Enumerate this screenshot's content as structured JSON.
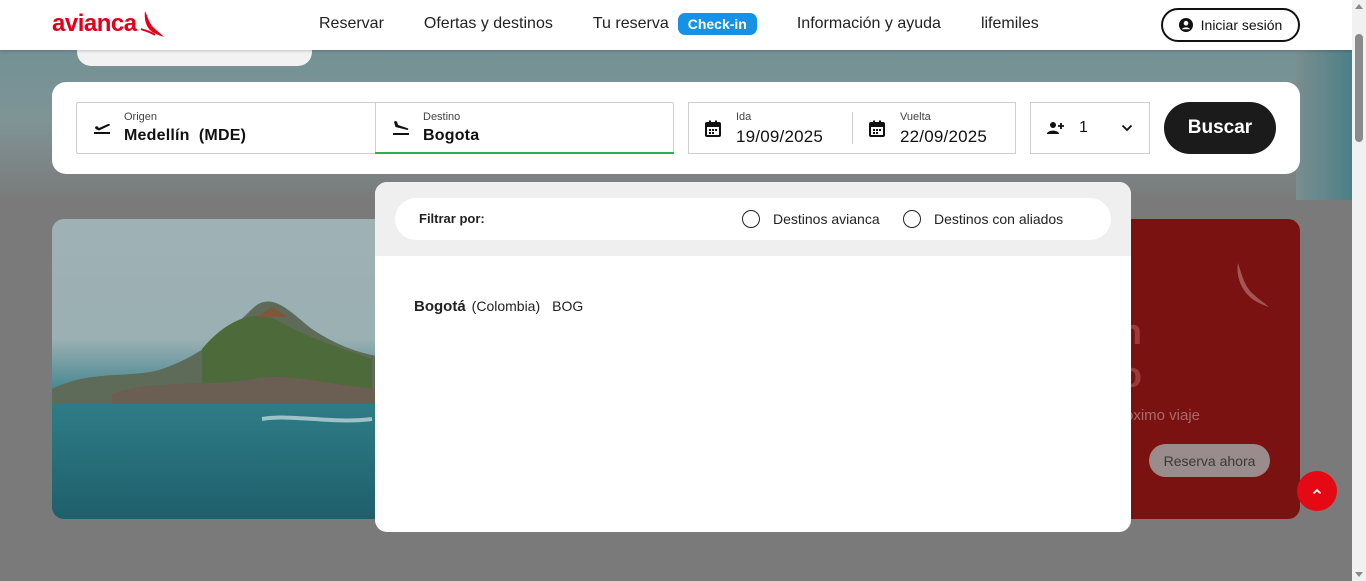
{
  "brand": {
    "name": "avianca",
    "color": "#e3001b"
  },
  "nav": {
    "reservar": "Reservar",
    "ofertas": "Ofertas y destinos",
    "tu_reserva": "Tu reserva",
    "checkin": "Check-in",
    "info": "Información y ayuda",
    "lifemiles": "lifemiles",
    "login": "Iniciar sesión"
  },
  "search": {
    "origin": {
      "label": "Origen",
      "value": "Medellín  (MDE)",
      "icon": "takeoff-icon"
    },
    "destination": {
      "label": "Destino",
      "value": "Bogota",
      "icon": "landing-icon"
    },
    "departure": {
      "label": "Ida",
      "value": "19/09/2025",
      "icon": "calendar-icon"
    },
    "return": {
      "label": "Vuelta",
      "value": "22/09/2025",
      "icon": "calendar-icon"
    },
    "passengers": {
      "value": "1",
      "icon": "add-person-icon"
    },
    "button": "Buscar"
  },
  "dropdown": {
    "filter_label": "Filtrar por:",
    "options": [
      "Destinos avianca",
      "Destinos con aliados"
    ],
    "results": [
      {
        "city": "Bogotá",
        "country": "(Colombia)",
        "code": "BOG"
      }
    ]
  },
  "promo": {
    "line1": "n",
    "line2": "o",
    "subtitle": "róximo viaje",
    "button": "Reserva ahora"
  },
  "colors": {
    "accent_green": "#2bb24c",
    "checkin_blue": "#1592e6",
    "scroll_top_red": "#e50914"
  }
}
